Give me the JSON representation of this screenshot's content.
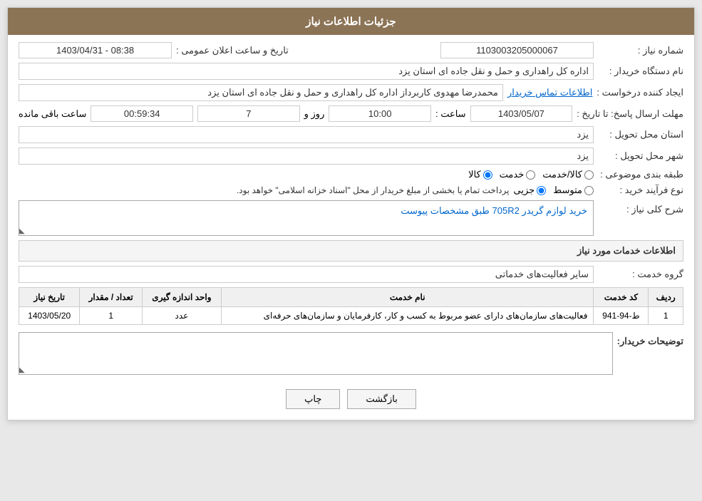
{
  "header": {
    "title": "جزئیات اطلاعات نیاز"
  },
  "fields": {
    "need_number_label": "شماره نیاز :",
    "need_number_value": "1103003205000067",
    "announcement_datetime_label": "تاریخ و ساعت اعلان عمومی :",
    "announcement_datetime_value": "1403/04/31 - 08:38",
    "buyer_org_label": "نام دستگاه خریدار :",
    "buyer_org_value": "اداره کل راهداری و حمل و نقل جاده ای استان یزد",
    "creator_label": "ایجاد کننده درخواست :",
    "creator_value": "محمدرضا مهدوی کاربرداز اداره کل راهداری و حمل و نقل جاده ای استان یزد",
    "contact_link": "اطلاعات تماس خریدار",
    "response_deadline_label": "مهلت ارسال پاسخ: تا تاریخ :",
    "response_date_value": "1403/05/07",
    "response_time_label": "ساعت :",
    "response_time_value": "10:00",
    "response_days_label": "روز و",
    "response_days_value": "7",
    "remaining_label": "ساعت باقی مانده",
    "remaining_value": "00:59:34",
    "delivery_province_label": "استان محل تحویل :",
    "delivery_province_value": "یزد",
    "delivery_city_label": "شهر محل تحویل :",
    "delivery_city_value": "یزد",
    "category_label": "طبقه بندی موضوعی :",
    "category_options": [
      "کالا",
      "خدمت",
      "کالا/خدمت"
    ],
    "category_selected": "کالا",
    "purchase_type_label": "نوع فرآیند خرید :",
    "purchase_type_options": [
      "جزیی",
      "متوسط"
    ],
    "purchase_type_selected": "جزیی",
    "purchase_type_note": "پرداخت تمام یا بخشی از مبلغ خریدار از محل \"اسناد خزانه اسلامی\" خواهد بود.",
    "need_description_label": "شرح کلی نیاز :",
    "need_description_value": "خرید لوازم گریدر 705R2 طبق مشخصات پیوست",
    "services_section_title": "اطلاعات خدمات مورد نیاز",
    "service_group_label": "گروه خدمت :",
    "service_group_value": "سایر فعالیت‌های خدماتی",
    "table_headers": {
      "row_number": "ردیف",
      "service_code": "کد خدمت",
      "service_name": "نام خدمت",
      "unit": "واحد اندازه گیری",
      "quantity": "تعداد / مقدار",
      "date": "تاریخ نیاز"
    },
    "table_rows": [
      {
        "row_number": "1",
        "service_code": "ط-94-941",
        "service_name": "فعالیت‌های سازمان‌های دارای عضو مربوط به کسب و کار، کارفرمایان و سازمان‌های حرفه‌ای",
        "unit": "عدد",
        "quantity": "1",
        "date": "1403/05/20"
      }
    ],
    "buyer_notes_label": "توضیحات خریدار:"
  },
  "buttons": {
    "print_label": "چاپ",
    "back_label": "بازگشت"
  }
}
